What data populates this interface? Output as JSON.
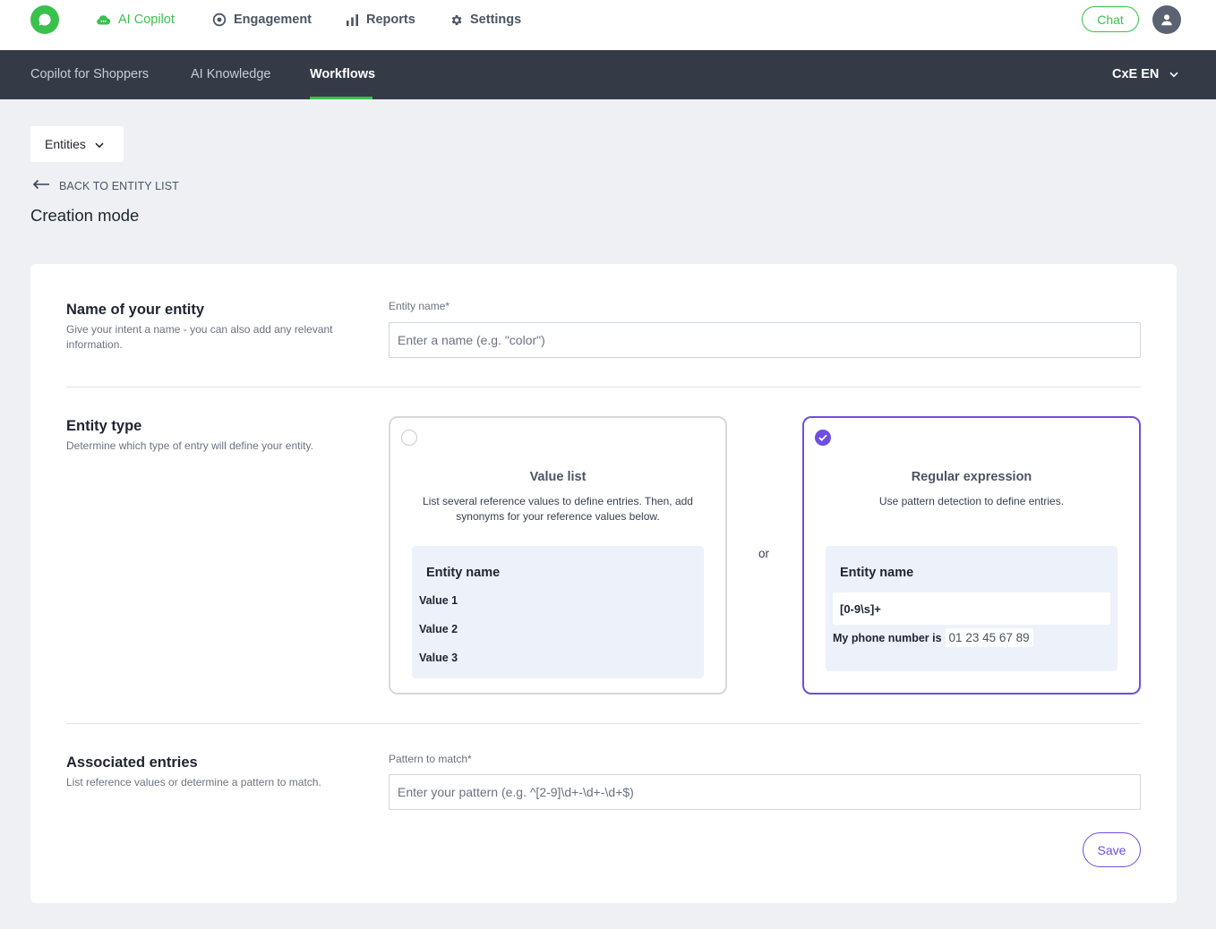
{
  "topnav": {
    "items": [
      {
        "label": "AI Copilot",
        "icon": "cloud-chat-icon",
        "active": true
      },
      {
        "label": "Engagement",
        "icon": "target-icon",
        "active": false
      },
      {
        "label": "Reports",
        "icon": "bar-chart-icon",
        "active": false
      },
      {
        "label": "Settings",
        "icon": "gear-icon",
        "active": false
      }
    ],
    "chat_label": "Chat"
  },
  "subnav": {
    "items": [
      {
        "label": "Copilot for Shoppers",
        "active": false
      },
      {
        "label": "AI Knowledge",
        "active": false
      },
      {
        "label": "Workflows",
        "active": true
      }
    ],
    "language": "CxE EN"
  },
  "header": {
    "dropdown_label": "Entities",
    "back_label": "BACK TO ENTITY LIST",
    "title": "Creation mode"
  },
  "form": {
    "name_section": {
      "title": "Name of your entity",
      "description": "Give your intent a name - you can also add any relevant information.",
      "field_label": "Entity name*",
      "placeholder": "Enter a name (e.g. \"color\")",
      "value": ""
    },
    "type_section": {
      "title": "Entity type",
      "description": "Determine which type of entry will define your entity.",
      "or_label": "or",
      "options": [
        {
          "title": "Value list",
          "description": "List several reference values to define entries. Then, add synonyms for your reference values below.",
          "selected": false,
          "preview_title": "Entity name",
          "preview_values": [
            "Value 1",
            "Value 2",
            "Value 3"
          ]
        },
        {
          "title": "Regular expression",
          "description": "Use pattern detection to define entries.",
          "selected": true,
          "preview_title": "Entity name",
          "preview_pattern": "[0-9\\s]+",
          "preview_sentence": "My phone number is",
          "preview_match": "01 23 45 67 89"
        }
      ]
    },
    "entries_section": {
      "title": "Associated entries",
      "description": "List reference values or determine a pattern to match.",
      "field_label": "Pattern to match*",
      "placeholder": "Enter your pattern (e.g. ^[2-9]\\d+-\\d+-\\d+$)",
      "value": ""
    },
    "save_label": "Save"
  },
  "colors": {
    "brand_green": "#3ac14b",
    "accent_purple": "#6e4ee0",
    "subnav_bg": "#343a46",
    "page_bg": "#eef0f4"
  }
}
